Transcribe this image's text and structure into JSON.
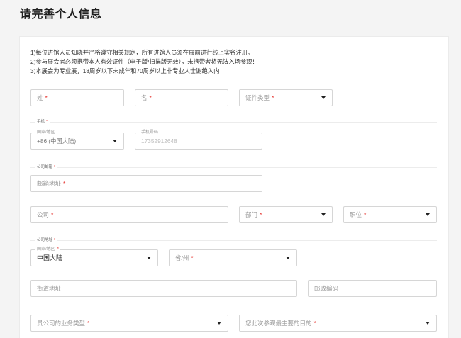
{
  "title": "请完善个人信息",
  "required_mark": "*",
  "theme": {
    "required_color": "#e5322d",
    "page_background": "#f4f4f4",
    "card_background": "#ffffff"
  },
  "notice": {
    "lines": [
      "1)每位进馆人员知晓并严格遵守相关规定，所有进馆人员须在展前进行线上实名注册。",
      "2)参与展会者必须携带本人有效证件（电子版/扫描版无效），未携带者将无法入场参观！",
      "3)本展会为专业展，18周岁以下未成年和70周岁以上非专业人士谢绝入内"
    ]
  },
  "form": {
    "last_name": {
      "placeholder": "姓"
    },
    "first_name": {
      "placeholder": "名"
    },
    "id_type": {
      "placeholder": "证件类型"
    },
    "mobile": {
      "group_label": "手机",
      "country": {
        "label": "国家/地区",
        "value": "+86 (中国大陆)"
      },
      "number": {
        "label": "手机号码",
        "value": "17352912648"
      }
    },
    "company_email": {
      "group_label": "公司邮箱",
      "email": {
        "placeholder": "邮箱地址"
      }
    },
    "company": {
      "placeholder": "公司"
    },
    "department": {
      "placeholder": "部门"
    },
    "position": {
      "placeholder": "职位"
    },
    "company_address": {
      "group_label": "公司地址",
      "country": {
        "label": "国家/地区",
        "value": "中国大陆"
      },
      "province": {
        "placeholder": "省/州"
      },
      "street": {
        "placeholder": "街道地址"
      },
      "postal_code": {
        "placeholder": "邮政编码"
      }
    },
    "business_type": {
      "placeholder": "贵公司的业务类型"
    },
    "visit_purpose": {
      "placeholder": "您此次参观最主要的目的"
    }
  }
}
